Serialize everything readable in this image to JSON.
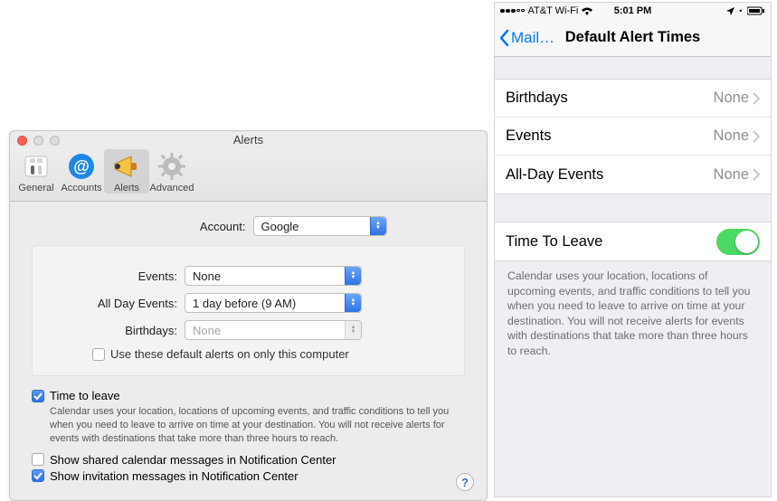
{
  "mac": {
    "title": "Alerts",
    "tabs": {
      "general": "General",
      "accounts": "Accounts",
      "alerts": "Alerts",
      "advanced": "Advanced"
    },
    "account_label": "Account:",
    "account_value": "Google",
    "rows": {
      "events_label": "Events:",
      "events_value": "None",
      "allday_label": "All Day Events:",
      "allday_value": "1 day before (9 AM)",
      "birthdays_label": "Birthdays:",
      "birthdays_value": "None"
    },
    "use_defaults_label": "Use these default alerts on only this computer",
    "time_to_leave_label": "Time to leave",
    "time_to_leave_desc": "Calendar uses your location, locations of upcoming events, and traffic conditions to tell you when you need to leave to arrive on time at your destination. You will not receive alerts for events with destinations that take more than three hours to reach.",
    "show_shared_label": "Show shared calendar messages in Notification Center",
    "show_invite_label": "Show invitation messages in Notification Center",
    "help": "?"
  },
  "phone": {
    "status": {
      "carrier": "AT&T Wi-Fi",
      "time": "5:01 PM"
    },
    "nav": {
      "back": "Mail…",
      "title": "Default Alert Times"
    },
    "rows": {
      "birthdays_label": "Birthdays",
      "birthdays_value": "None",
      "events_label": "Events",
      "events_value": "None",
      "allday_label": "All-Day Events",
      "allday_value": "None",
      "ttl_label": "Time To Leave"
    },
    "footer": "Calendar uses your location, locations of upcoming events, and traffic conditions to tell you when you need to leave to arrive on time at your destination. You will not receive alerts for events with destinations that take more than three hours to reach."
  }
}
